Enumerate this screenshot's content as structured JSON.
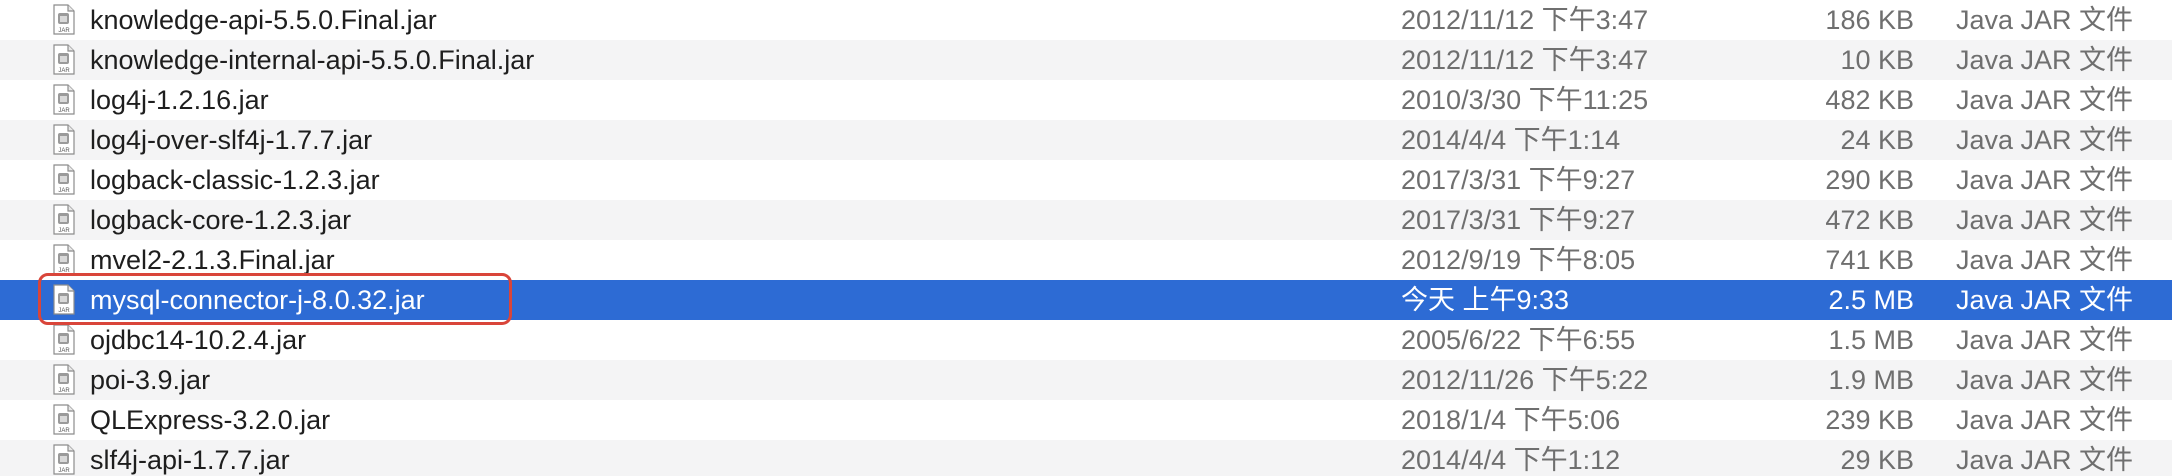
{
  "files": [
    {
      "name": "knowledge-api-5.5.0.Final.jar",
      "date": "2012/11/12 下午3:47",
      "size": "186 KB",
      "kind": "Java JAR 文件",
      "selected": false
    },
    {
      "name": "knowledge-internal-api-5.5.0.Final.jar",
      "date": "2012/11/12 下午3:47",
      "size": "10 KB",
      "kind": "Java JAR 文件",
      "selected": false
    },
    {
      "name": "log4j-1.2.16.jar",
      "date": "2010/3/30 下午11:25",
      "size": "482 KB",
      "kind": "Java JAR 文件",
      "selected": false
    },
    {
      "name": "log4j-over-slf4j-1.7.7.jar",
      "date": "2014/4/4 下午1:14",
      "size": "24 KB",
      "kind": "Java JAR 文件",
      "selected": false
    },
    {
      "name": "logback-classic-1.2.3.jar",
      "date": "2017/3/31 下午9:27",
      "size": "290 KB",
      "kind": "Java JAR 文件",
      "selected": false
    },
    {
      "name": "logback-core-1.2.3.jar",
      "date": "2017/3/31 下午9:27",
      "size": "472 KB",
      "kind": "Java JAR 文件",
      "selected": false
    },
    {
      "name": "mvel2-2.1.3.Final.jar",
      "date": "2012/9/19 下午8:05",
      "size": "741 KB",
      "kind": "Java JAR 文件",
      "selected": false
    },
    {
      "name": "mysql-connector-j-8.0.32.jar",
      "date": "今天 上午9:33",
      "size": "2.5 MB",
      "kind": "Java JAR 文件",
      "selected": true
    },
    {
      "name": "ojdbc14-10.2.4.jar",
      "date": "2005/6/22 下午6:55",
      "size": "1.5 MB",
      "kind": "Java JAR 文件",
      "selected": false
    },
    {
      "name": "poi-3.9.jar",
      "date": "2012/11/26 下午5:22",
      "size": "1.9 MB",
      "kind": "Java JAR 文件",
      "selected": false
    },
    {
      "name": "QLExpress-3.2.0.jar",
      "date": "2018/1/4 下午5:06",
      "size": "239 KB",
      "kind": "Java JAR 文件",
      "selected": false
    },
    {
      "name": "slf4j-api-1.7.7.jar",
      "date": "2014/4/4 下午1:12",
      "size": "29 KB",
      "kind": "Java JAR 文件",
      "selected": false
    }
  ],
  "icon": {
    "name": "jar-file-icon",
    "label": "JAR"
  },
  "colors": {
    "selection": "#2d6bd4",
    "alt_row": "#f4f4f5",
    "annotation": "#d9453a"
  }
}
